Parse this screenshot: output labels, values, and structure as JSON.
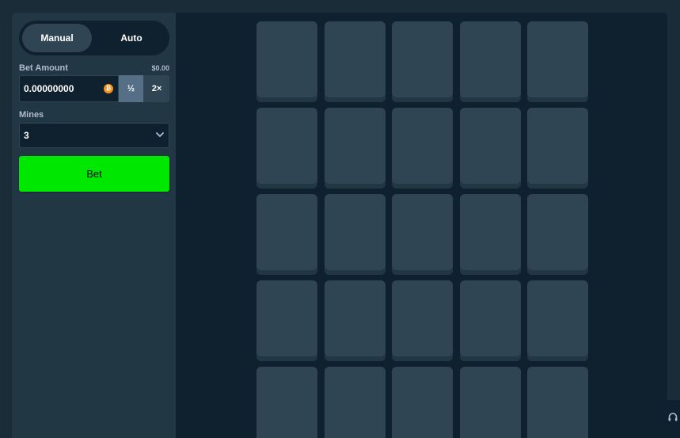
{
  "sidebar": {
    "mode_tabs": {
      "manual": "Manual",
      "auto": "Auto"
    },
    "bet_amount": {
      "label": "Bet Amount",
      "usd_value": "$0.00",
      "value": "0.00000000",
      "currency_icon": "bitcoin-icon",
      "half_label": "½",
      "double_label": "2×"
    },
    "mines": {
      "label": "Mines",
      "selected": "3"
    },
    "bet_button_label": "Bet"
  },
  "grid": {
    "rows": 5,
    "cols": 5,
    "tile_state": "hidden"
  },
  "colors": {
    "accent_green": "#00e701",
    "panel": "#213743",
    "background": "#0f212e",
    "tile": "#2f4553"
  },
  "support_icon": "headset-icon"
}
